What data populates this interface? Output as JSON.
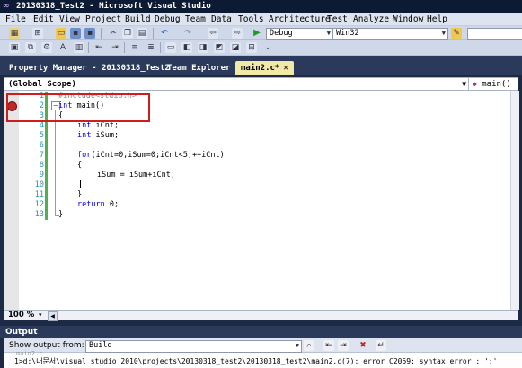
{
  "window": {
    "title": "20130318_Test2 - Microsoft Visual Studio",
    "logo_text": "∞"
  },
  "menu": [
    "File",
    "Edit",
    "View",
    "Project",
    "Build",
    "Debug",
    "Team",
    "Data",
    "Tools",
    "Architecture",
    "Test",
    "Analyze",
    "Window",
    "Help"
  ],
  "toolbar": {
    "configuration": "Debug",
    "platform": "Win32",
    "start_icon": "play-icon"
  },
  "tabs": [
    {
      "label": "Property Manager - 20130318_Test2"
    },
    {
      "label": "Team Explorer"
    },
    {
      "label": "main2.c*",
      "close": "✕",
      "active": true
    }
  ],
  "scope": {
    "left": "(Global Scope)",
    "right": "main()",
    "right_icon": "◆"
  },
  "editor": {
    "line_numbers": [
      "1",
      "2",
      "3",
      "4",
      "5",
      "6",
      "7",
      "8",
      "9",
      "10",
      "11",
      "12",
      "13"
    ],
    "lines": {
      "l1_pp": "#include<stdio.h>",
      "l2_kw": "int",
      "l2_rest": " main()",
      "l3": "{",
      "l4_kw": "int",
      "l4_rest": " iCnt;",
      "l5_kw": "int",
      "l5_rest": " iSum;",
      "l7_kw": "for",
      "l7_rest": "(iCnt=0,iSum=0;iCnt<5;++iCnt)",
      "l8": "{",
      "l9": "iSum = iSum+iCnt;",
      "l11": "}",
      "l12_kw": "return",
      "l12_rest": " 0;",
      "l13": "}"
    },
    "fold_symbol": "−"
  },
  "zoom": {
    "value": "100 %",
    "arrow": "▾"
  },
  "output": {
    "title": "Output",
    "show_label": "Show output from:",
    "source": "Build",
    "line0": "main2.c",
    "line1": "1>d:\\내문서\\visual studio 2010\\projects\\20130318_test2\\20130318_test2\\main2.c(7): error C2059: syntax error : ';'"
  }
}
